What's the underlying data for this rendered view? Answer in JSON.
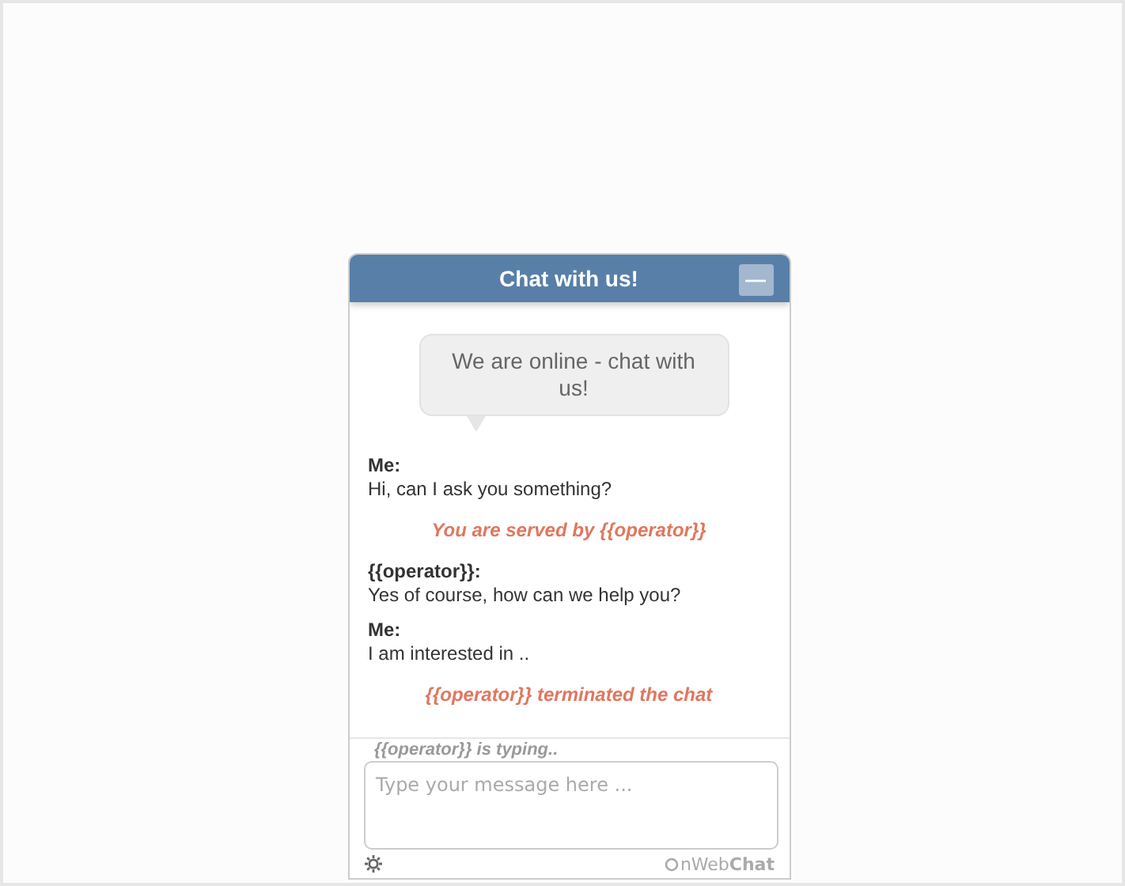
{
  "widget": {
    "title": "Chat with us!",
    "minimize_label": "—"
  },
  "welcome": "We are online - chat with us!",
  "messages": [
    {
      "kind": "message",
      "sender": "Me:",
      "text": "Hi, can I ask you something?"
    },
    {
      "kind": "system",
      "text": "You are served by {{operator}}"
    },
    {
      "kind": "message",
      "sender": "{{operator}}:",
      "text": "Yes of course, how can we help you?"
    },
    {
      "kind": "message",
      "sender": "Me:",
      "text": "I am interested in .."
    },
    {
      "kind": "system",
      "text": "{{operator}} terminated the chat"
    }
  ],
  "typing": "{{operator}} is typing..",
  "input": {
    "placeholder": "Type your message here ..."
  },
  "brand": "nWeb**Chat**"
}
